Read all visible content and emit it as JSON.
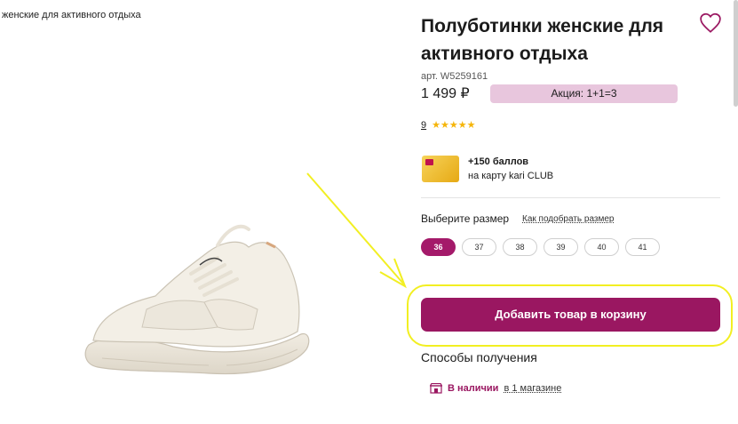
{
  "breadcrumb": {
    "current": "женские для активного отдыха"
  },
  "product": {
    "title": "Полуботинки женские для активного отдыха",
    "article": "арт. W5259161",
    "price": "1 499 ₽",
    "promo": "Акция: 1+1=3",
    "rating_count": "9",
    "stars": "★★★★★"
  },
  "bonus": {
    "points": "+150 баллов",
    "card_text": "на карту kari CLUB"
  },
  "sizes": {
    "label": "Выберите размер",
    "guide_link": "Как подобрать размер",
    "options": [
      "36",
      "37",
      "38",
      "39",
      "40",
      "41"
    ],
    "selected": "36"
  },
  "cart": {
    "button_label": "Добавить товар в корзину"
  },
  "delivery": {
    "title": "Способы получения",
    "status": "В наличии",
    "link": "в 1 магазине"
  },
  "colors": {
    "accent": "#9a1761",
    "promo_bg": "#e8c6dd",
    "highlight": "#f2ef22",
    "stars": "#f5b50a"
  },
  "icons": {
    "favorite": "heart-outline-icon",
    "store": "store-icon"
  }
}
